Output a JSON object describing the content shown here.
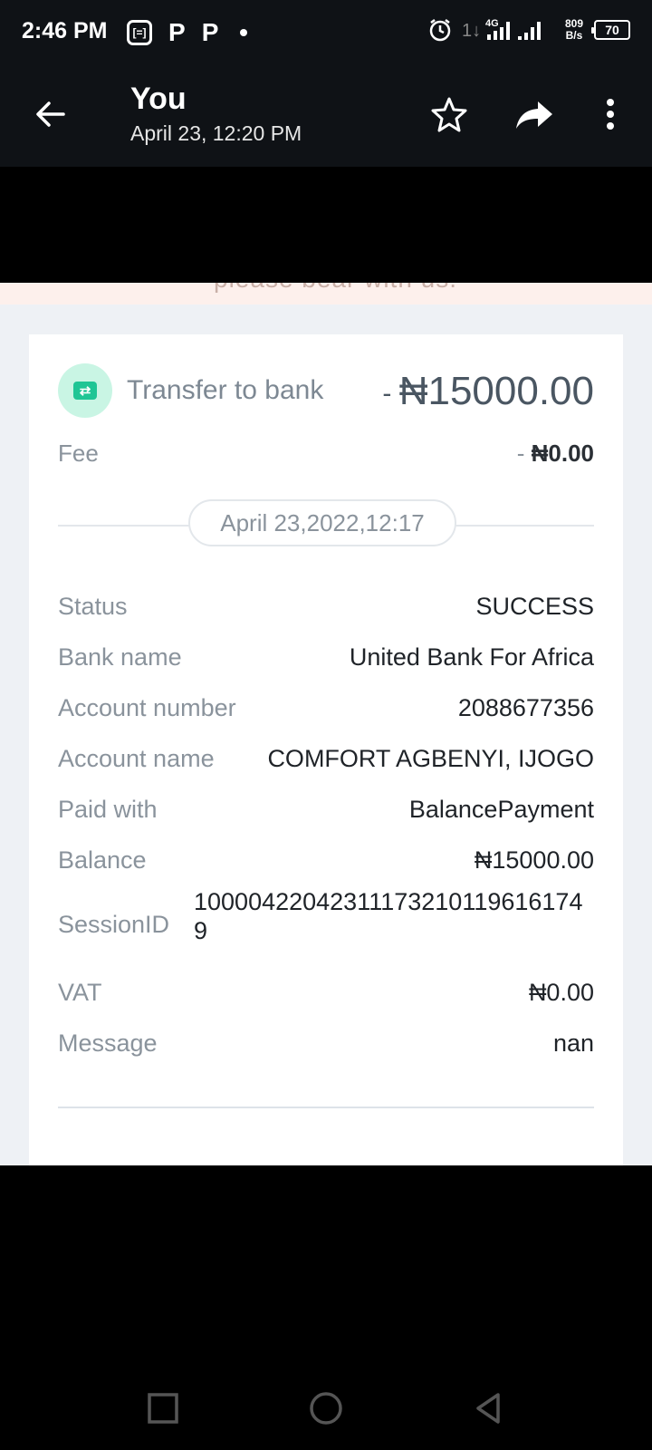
{
  "status_bar": {
    "time": "2:46 PM",
    "notif_box_label": "[=]",
    "notif_p1": "P",
    "notif_p2": "P",
    "network": "4G",
    "speed_value": "809",
    "speed_unit": "B/s",
    "battery": "70"
  },
  "header": {
    "title": "You",
    "subtitle": "April 23, 12:20 PM"
  },
  "banner": {
    "partial_text": "please bear with us."
  },
  "receipt": {
    "transaction_type": "Transfer to bank",
    "amount_sign": "- ",
    "amount": "₦15000.00",
    "fee_label": "Fee",
    "fee_sign": "- ",
    "fee_value": "₦0.00",
    "date": "April 23,2022,12:17",
    "details": [
      {
        "label": "Status",
        "value": "SUCCESS"
      },
      {
        "label": "Bank name",
        "value": "United Bank For Africa"
      },
      {
        "label": "Account number",
        "value": "2088677356"
      },
      {
        "label": "Account name",
        "value": "COMFORT AGBENYI, IJOGO"
      },
      {
        "label": "Paid with",
        "value": "BalancePayment"
      },
      {
        "label": "Balance",
        "value": "₦15000.00"
      },
      {
        "label": "SessionID",
        "value": "100004220423111732101196161749"
      },
      {
        "label": "VAT",
        "value": "₦0.00"
      },
      {
        "label": "Message",
        "value": "nan"
      }
    ]
  },
  "colors": {
    "header_bg": "#0f1216",
    "accent_green": "#1fc595",
    "card_bg": "#ffffff",
    "page_bg": "#eef1f5"
  },
  "icons": [
    "back-arrow-icon",
    "star-icon",
    "share-icon",
    "more-vert-icon",
    "transfer-icon",
    "alarm-icon",
    "signal-icon",
    "battery-icon",
    "nav-square-icon",
    "nav-circle-icon",
    "nav-triangle-icon"
  ]
}
